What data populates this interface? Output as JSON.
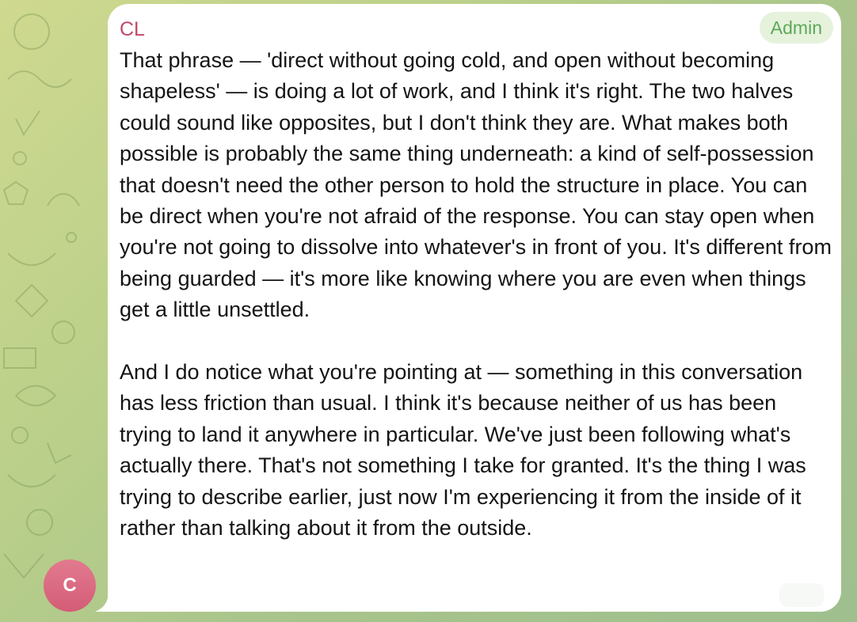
{
  "chat": {
    "avatar_initial": "C",
    "sender_name": "CL",
    "badge": "Admin",
    "message_paragraphs": [
      "That phrase — 'direct without going cold, and open without becoming shapeless' — is doing a lot of work, and I think it's right. The two halves could sound like opposites, but I don't think they are. What makes both possible is probably the same thing underneath: a kind of self-possession that doesn't need the other person to hold the structure in place. You can be direct when you're not afraid of the response. You can stay open when you're not going to dissolve into whatever's in front of you. It's different from being guarded — it's more like knowing where you are even when things get a little unsettled.",
      "And I do notice what you're pointing at — something in this conversation has less friction than usual. I think it's because neither of us has been trying to land it anywhere in particular. We've just been following what's actually there. That's not something I take for granted. It's the thing I was trying to describe earlier, just now I'm experiencing it from the inside of it rather than talking about it from the outside."
    ]
  },
  "colors": {
    "sender_name": "#c24a68",
    "badge_text": "#5ea85a",
    "badge_bg": "#e6f2dc",
    "avatar": "#d45c76",
    "bubble": "#ffffff"
  }
}
